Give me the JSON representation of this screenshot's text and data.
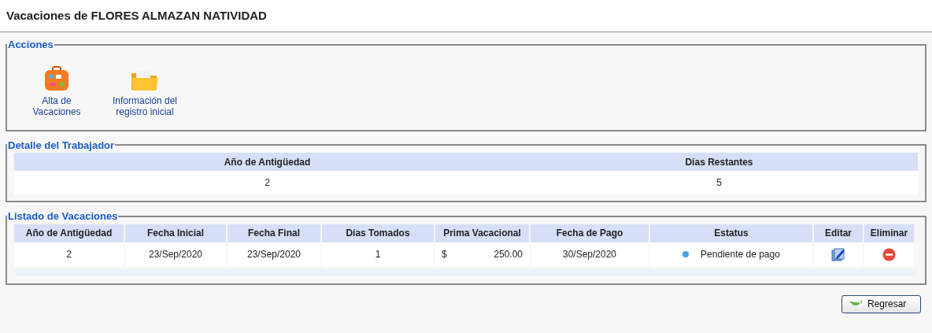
{
  "title": "Vacaciones de FLORES ALMAZAN NATIVIDAD",
  "acciones": {
    "legend": "Acciones",
    "items": [
      {
        "kind": "suitcase",
        "label": "Alta de Vacaciones"
      },
      {
        "kind": "folder",
        "label": "Información del registro inicial"
      }
    ]
  },
  "detalle": {
    "legend": "Detalle del Trabajador",
    "columns": [
      "Año de Antigüedad",
      "Días Restantes"
    ],
    "values": [
      "2",
      "5"
    ]
  },
  "listado": {
    "legend": "Listado de Vacaciones",
    "columns": [
      "Año de Antigüedad",
      "Fecha Inicial",
      "Fecha Final",
      "Días Tomados",
      "Prima Vacacional",
      "Fecha de Pago",
      "Estatus",
      "Editar",
      "Eliminar"
    ],
    "rows": [
      {
        "antiguedad": "2",
        "fecha_inicial": "23/Sep/2020",
        "fecha_final": "23/Sep/2020",
        "dias": "1",
        "currency": "$",
        "prima": "250.00",
        "fecha_pago": "30/Sep/2020",
        "status": {
          "label": "Pendiente de pago",
          "color": "#4aa3df"
        }
      }
    ]
  },
  "back_button": "Regresar"
}
